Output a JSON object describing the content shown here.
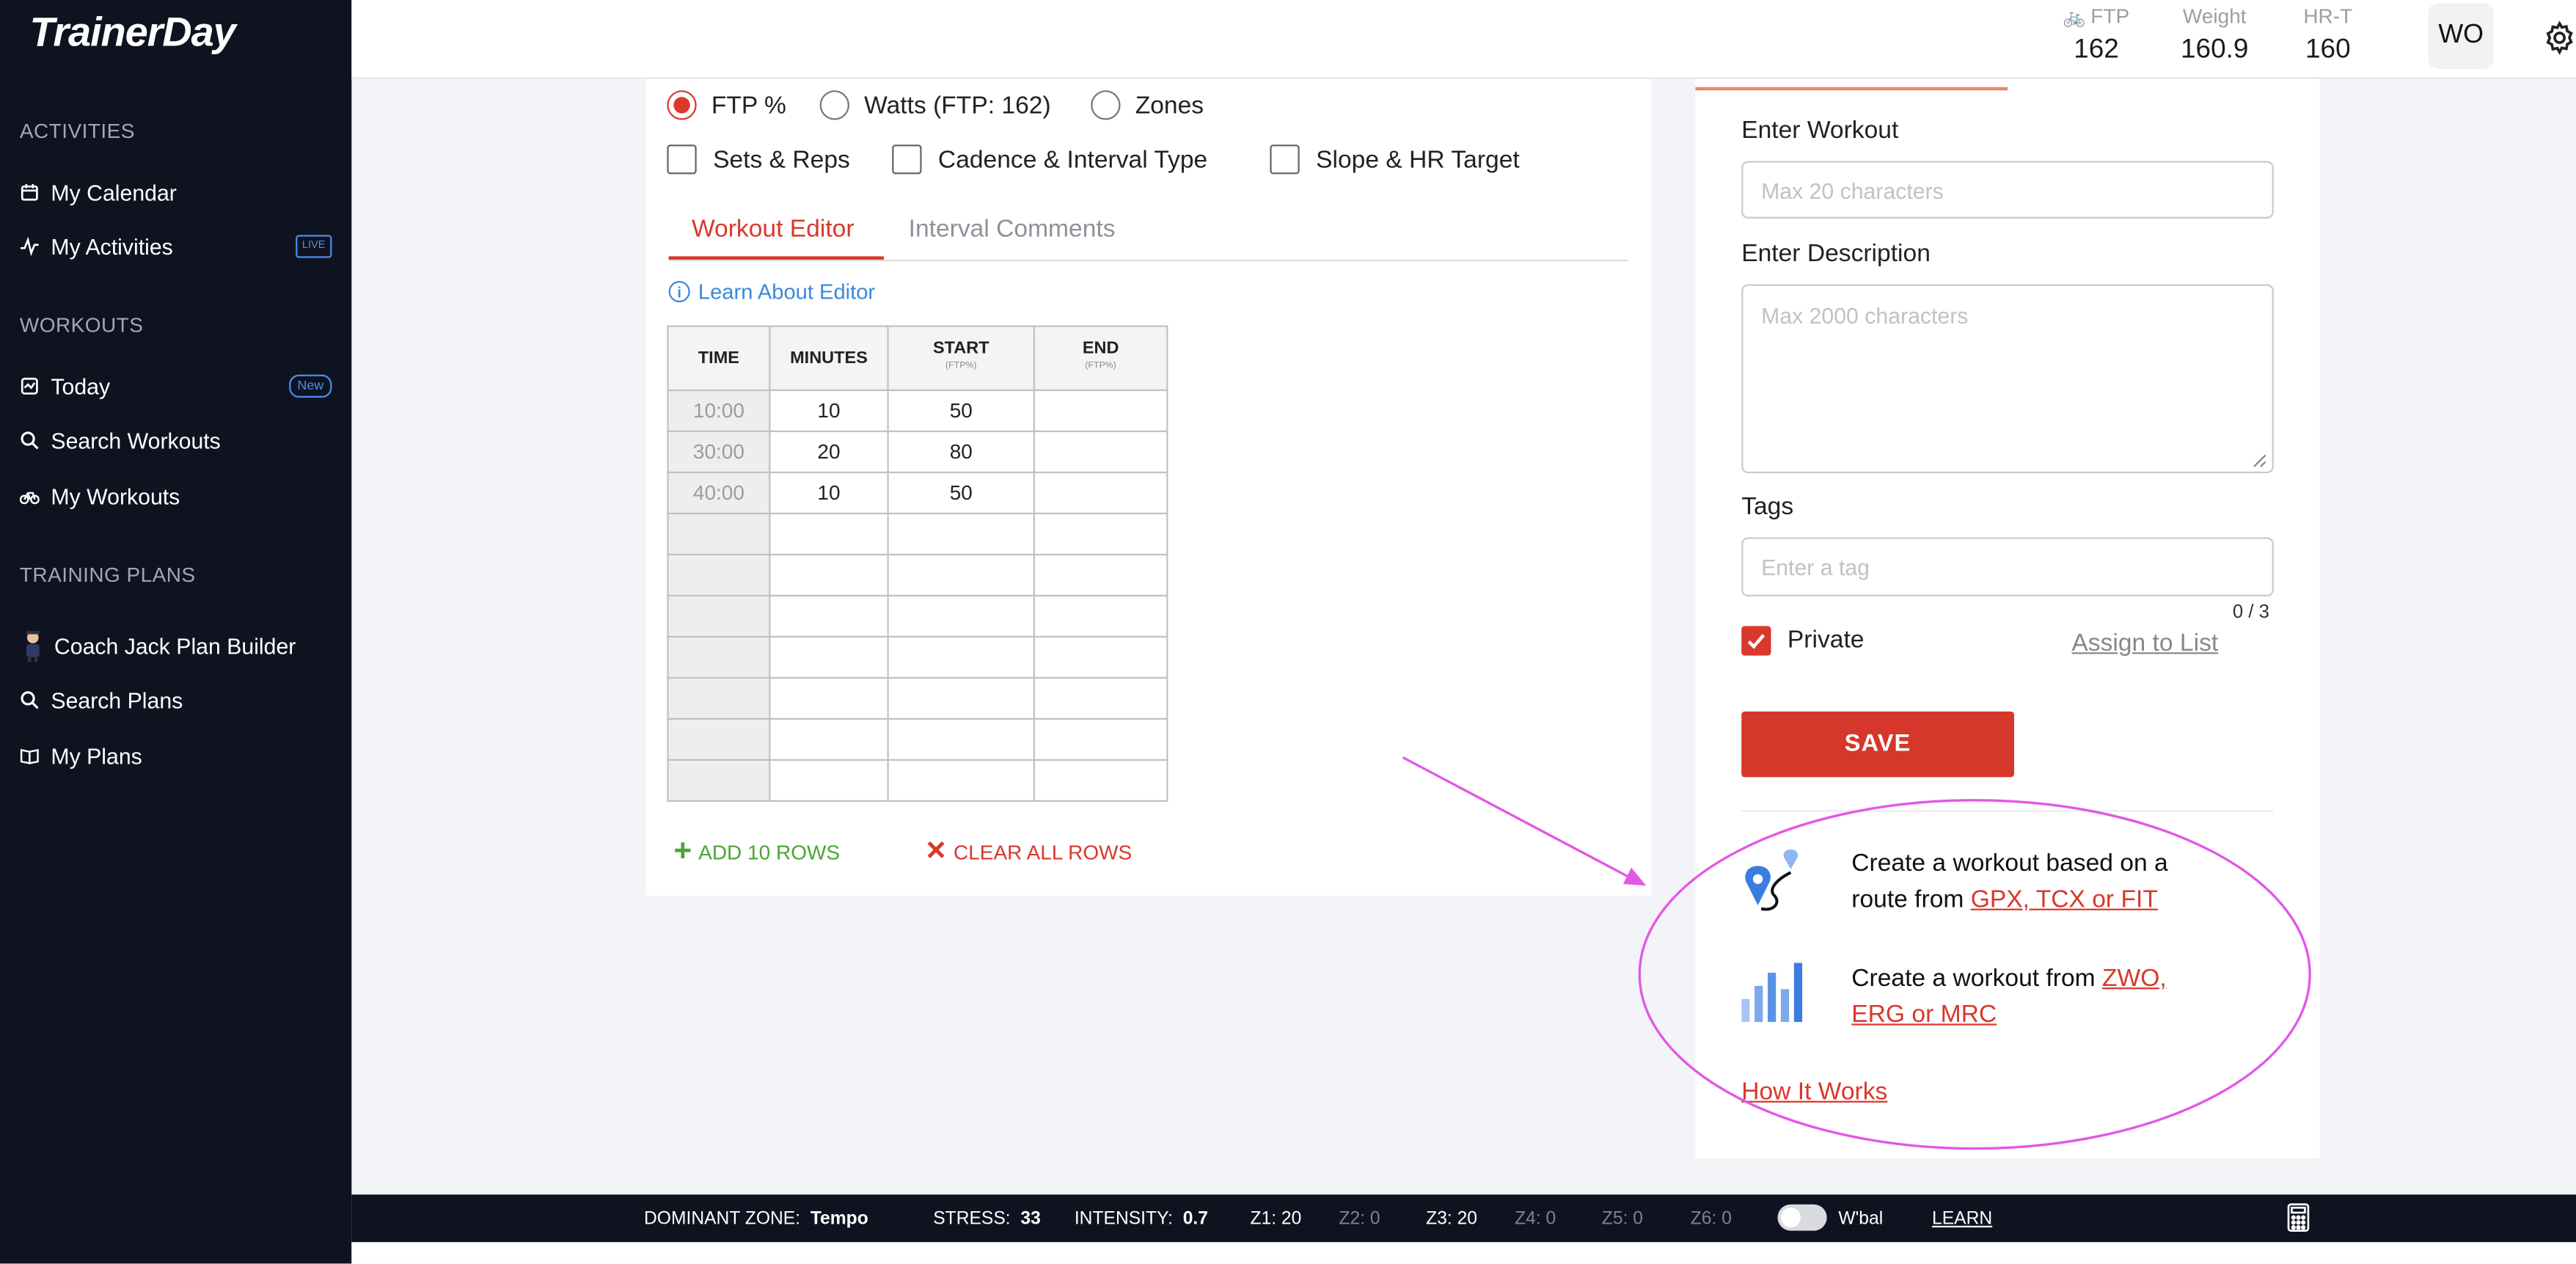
{
  "brand": {
    "logo": "TrainerDay"
  },
  "sidebar": {
    "sections": [
      {
        "title": "ACTIVITIES"
      },
      {
        "title": "WORKOUTS"
      },
      {
        "title": "TRAINING PLANS"
      }
    ],
    "items": [
      {
        "label": "My Calendar",
        "icon": "calendar-icon"
      },
      {
        "label": "My Activities",
        "icon": "activity-icon",
        "badge": "LIVE"
      },
      {
        "label": "Today",
        "icon": "today-icon",
        "badge": "New"
      },
      {
        "label": "Search Workouts",
        "icon": "search-icon"
      },
      {
        "label": "My Workouts",
        "icon": "bike-icon"
      },
      {
        "label": "Coach Jack Plan Builder",
        "icon": "coach-jack-icon"
      },
      {
        "label": "Search Plans",
        "icon": "search-icon"
      },
      {
        "label": "My Plans",
        "icon": "book-icon"
      }
    ]
  },
  "header": {
    "stats": [
      {
        "label": "FTP",
        "value": "162"
      },
      {
        "label": "Weight",
        "value": "160.9"
      },
      {
        "label": "HR-T",
        "value": "160"
      }
    ],
    "avatar": "WO"
  },
  "editor": {
    "radios": [
      {
        "label": "FTP %",
        "selected": true
      },
      {
        "label": "Watts (FTP: 162)",
        "selected": false
      },
      {
        "label": "Zones",
        "selected": false
      }
    ],
    "checkboxes": [
      {
        "label": "Sets & Reps"
      },
      {
        "label": "Cadence & Interval Type"
      },
      {
        "label": "Slope & HR Target"
      }
    ],
    "tabs": [
      {
        "label": "Workout Editor"
      },
      {
        "label": "Interval Comments"
      }
    ],
    "learn_link": "Learn About Editor",
    "table": {
      "headers": [
        "TIME",
        "MINUTES",
        "START",
        "END"
      ],
      "subheaders": [
        "",
        "",
        "(FTP%)",
        "(FTP%)"
      ],
      "rows": [
        [
          "10:00",
          "10",
          "50",
          ""
        ],
        [
          "30:00",
          "20",
          "80",
          ""
        ],
        [
          "40:00",
          "10",
          "50",
          ""
        ],
        [
          "",
          "",
          "",
          ""
        ],
        [
          "",
          "",
          "",
          ""
        ],
        [
          "",
          "",
          "",
          ""
        ],
        [
          "",
          "",
          "",
          ""
        ],
        [
          "",
          "",
          "",
          ""
        ],
        [
          "",
          "",
          "",
          ""
        ],
        [
          "",
          "",
          "",
          ""
        ]
      ]
    },
    "add_rows": "ADD 10 ROWS",
    "clear_rows": "CLEAR ALL ROWS"
  },
  "panel": {
    "workout_label": "Enter Workout",
    "workout_placeholder": "Max 20 characters",
    "description_label": "Enter Description",
    "description_placeholder": "Max 2000 characters",
    "tags_label": "Tags",
    "tags_placeholder": "Enter a tag",
    "tags_counter": "0 / 3",
    "private_label": "Private",
    "assign_link": "Assign to List",
    "save_label": "SAVE",
    "route_text": "Create a workout based on a route from ",
    "route_link": "GPX, TCX or FIT",
    "file_text": "Create a workout from ",
    "file_link": "ZWO, ERG or MRC",
    "how_it_works": "How It Works"
  },
  "footer": {
    "dominant_zone_label": "DOMINANT ZONE:",
    "dominant_zone_value": "Tempo",
    "stress_label": "STRESS:",
    "stress_value": "33",
    "intensity_label": "INTENSITY:",
    "intensity_value": "0.7",
    "zones": [
      "Z1: 20",
      "Z2: 0",
      "Z3: 20",
      "Z4: 0",
      "Z5: 0",
      "Z6: 0"
    ],
    "wbal_label": "W'bal",
    "learn_label": "LEARN"
  },
  "colors": {
    "accent": "#d9382b",
    "sidebar_bg": "#0f1320",
    "link_blue": "#3b89d8",
    "add_green": "#4aa534",
    "annotation": "#e257e6"
  }
}
